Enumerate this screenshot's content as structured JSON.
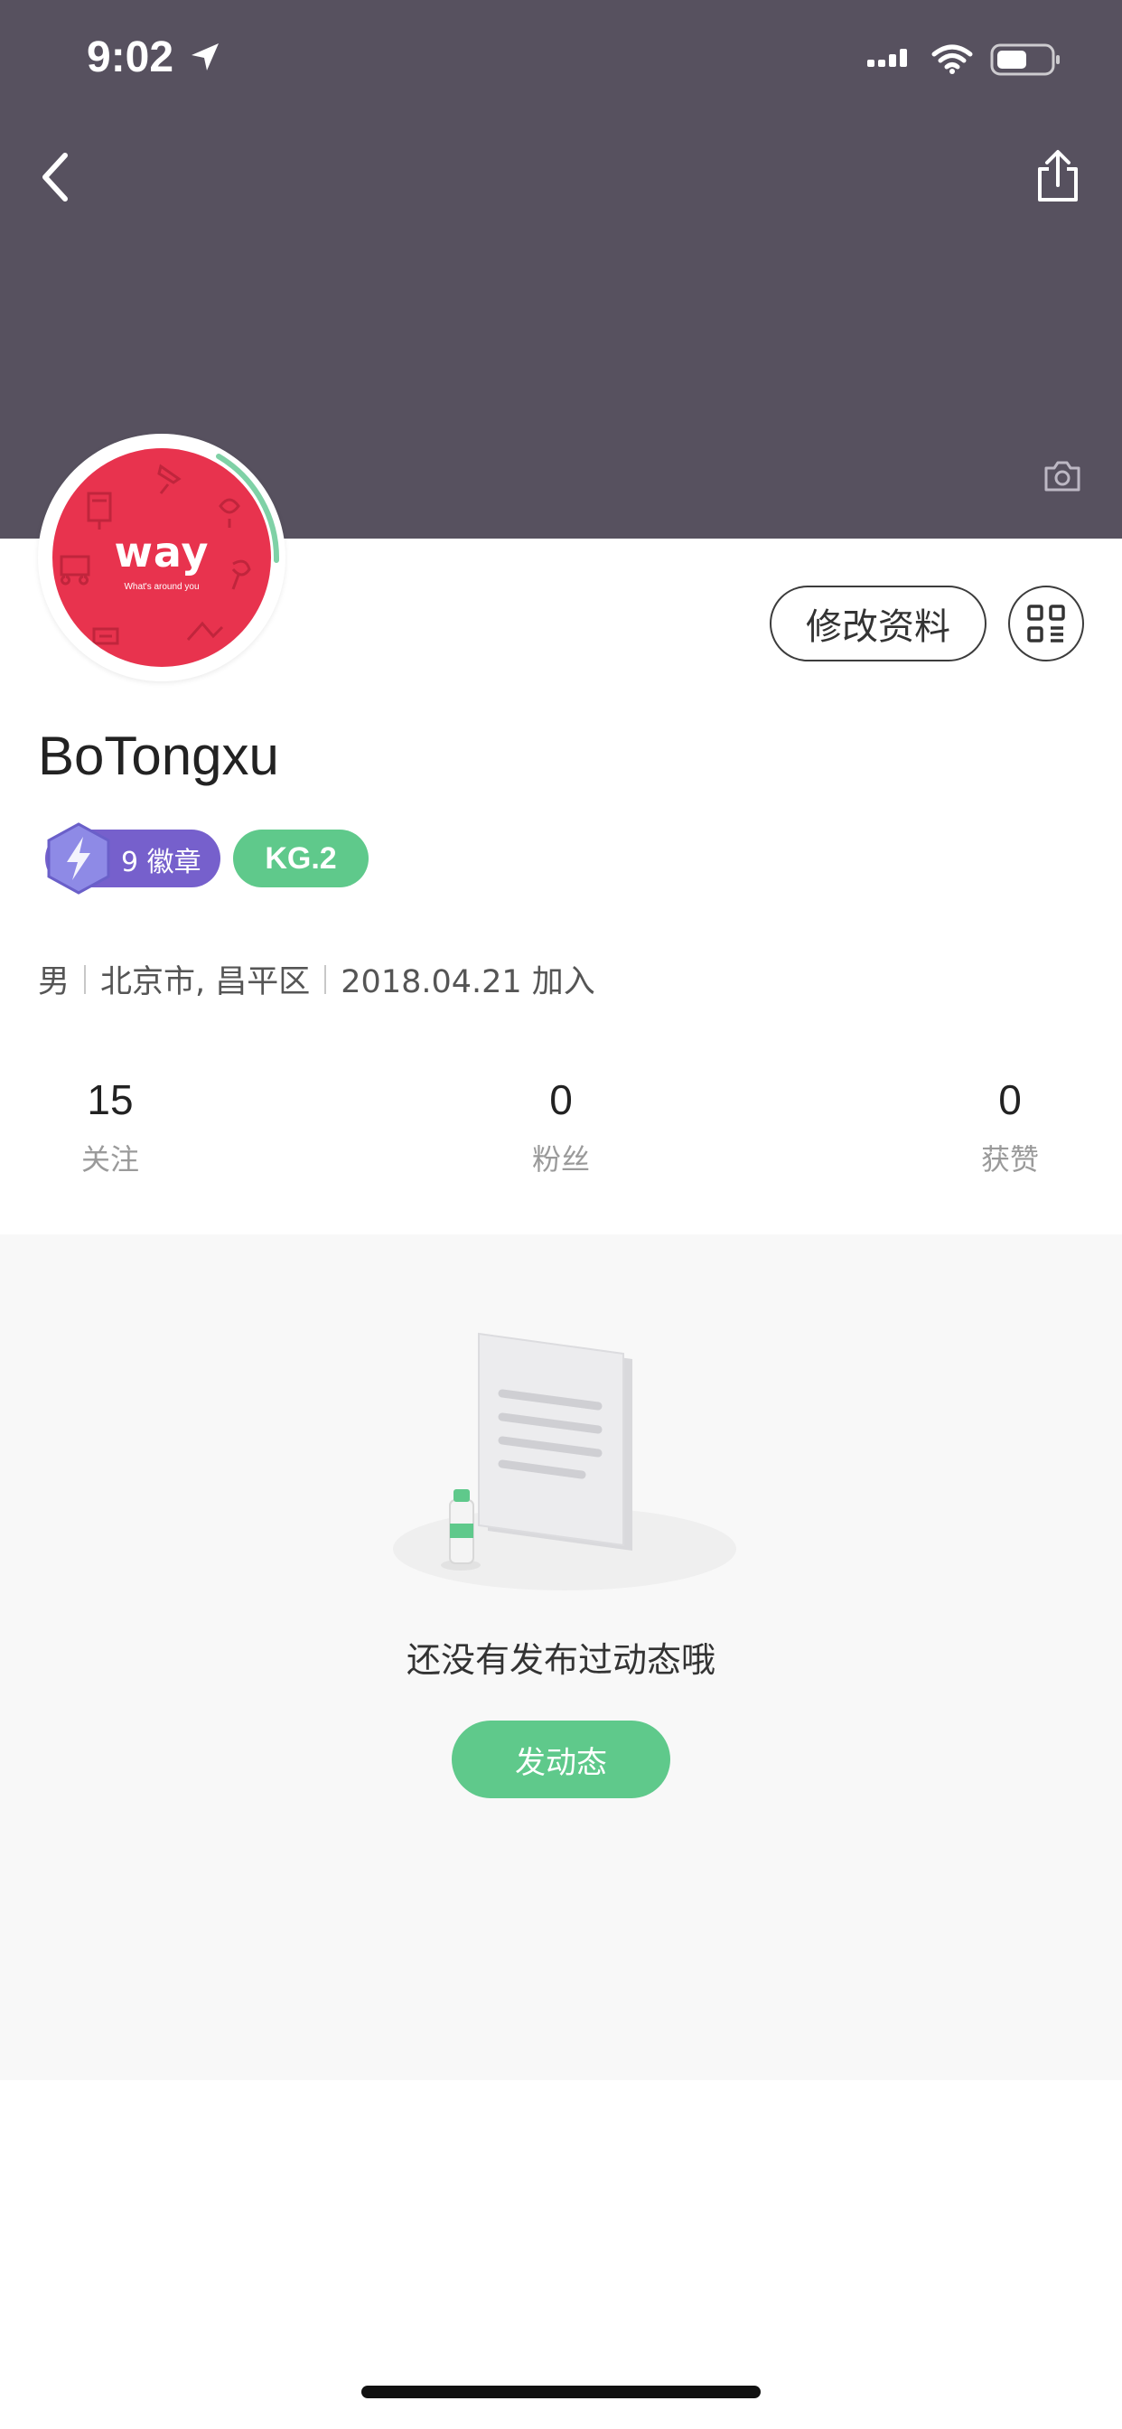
{
  "status_bar": {
    "time": "9:02",
    "icons": [
      "location-arrow-icon",
      "cellular-signal-icon",
      "wifi-icon",
      "battery-icon"
    ]
  },
  "header": {
    "background_color": "#57515f",
    "back_icon": "chevron-left-icon",
    "share_icon": "share-icon",
    "camera_icon": "camera-icon"
  },
  "avatar": {
    "title": "way",
    "subtitle": "What's around you",
    "background_color": "#e8334e",
    "ring_color": "#7fd1a6"
  },
  "actions": {
    "edit_profile_label": "修改资料",
    "qr_icon": "qr-code-icon"
  },
  "profile": {
    "username": "BoTongxu",
    "badges_label": "9 徽章",
    "level_label": "KG.2",
    "badge_color": "#7660cc",
    "level_color": "#5fc98b",
    "gender": "男",
    "location": "北京市, 昌平区",
    "joined": "2018.04.21 加入"
  },
  "stats": [
    {
      "value": "15",
      "label": "关注"
    },
    {
      "value": "0",
      "label": "粉丝"
    },
    {
      "value": "0",
      "label": "获赞"
    }
  ],
  "empty_state": {
    "message": "还没有发布过动态哦",
    "button_label": "发动态",
    "illustration": "empty-document-illustration"
  },
  "accent_color": "#5fc98b"
}
